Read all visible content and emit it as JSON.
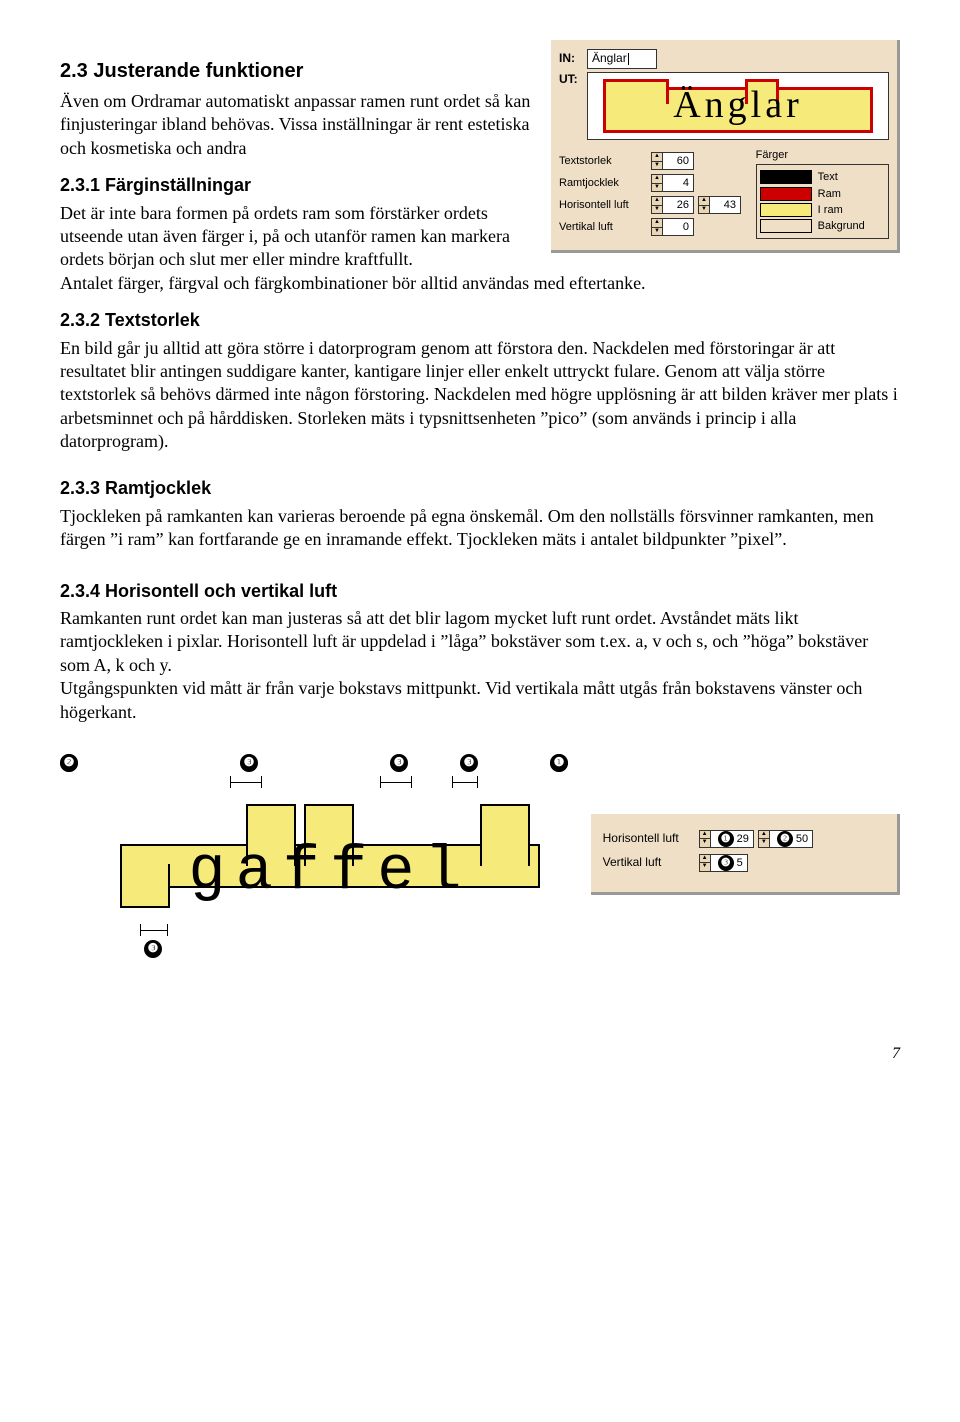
{
  "section": {
    "h_2_3": "2.3  Justerande funktioner",
    "p_2_3": "Även om Ordramar automatiskt anpassar ramen runt ordet så kan finjusteringar ibland behövas. Vissa inställningar är rent estetiska och kosmetiska och andra",
    "h_2_3_1": "2.3.1  Färginställningar",
    "p_2_3_1": "Det är inte bara formen på ordets ram som förstärker ordets utseende utan även färger i, på och utanför ramen kan markera ordets början och slut mer eller mindre kraftfullt.\nAntalet färger, färgval och färgkombinationer bör alltid användas med eftertanke.",
    "h_2_3_2": "2.3.2  Textstorlek",
    "p_2_3_2": "En bild går ju alltid att göra större i datorprogram genom att förstora den. Nackdelen med förstoringar är att resultatet blir antingen suddigare kanter, kantigare linjer eller enkelt uttryckt fulare. Genom att välja större textstorlek så behövs därmed inte någon förstoring. Nackdelen med högre upplösning är att bilden kräver mer plats i arbetsminnet och på hårddisken. Storleken mäts i typsnittsenheten ”pico” (som används i princip i alla datorprogram).",
    "h_2_3_3": "2.3.3  Ramtjocklek",
    "p_2_3_3": "Tjockleken på ramkanten kan varieras beroende på egna önskemål. Om den nollställs försvinner ramkanten, men färgen ”i ram” kan fortfarande ge en inramande effekt. Tjockleken mäts i antalet bildpunkter ”pixel”.",
    "h_2_3_4": "2.3.4  Horisontell och vertikal luft",
    "p_2_3_4": "Ramkanten runt ordet kan man justeras så att det blir lagom mycket luft runt ordet. Avståndet mäts likt ramtjockleken i pixlar. Horisontell luft är uppdelad i ”låga” bokstäver som t.ex.  a, v och s, och ”höga” bokstäver som A, k och y.\nUtgångspunkten vid mått är från varje bokstavs mittpunkt. Vid vertikala mått utgås från bokstavens vänster och högerkant."
  },
  "panel": {
    "in_label": "IN:",
    "in_value": "Änglar",
    "ut_label": "UT:",
    "preview_word": "Änglar",
    "controls": {
      "textstorlek": {
        "label": "Textstorlek",
        "value": "60"
      },
      "ramtjocklek": {
        "label": "Ramtjocklek",
        "value": "4"
      },
      "horisontell": {
        "label": "Horisontell luft",
        "value1": "26",
        "value2": "43"
      },
      "vertikal": {
        "label": "Vertikal luft",
        "value": "0"
      }
    },
    "colors": {
      "title": "Färger",
      "text": "Text",
      "ram": "Ram",
      "iram": "I ram",
      "bakgrund": "Bakgrund"
    }
  },
  "gaffel": {
    "word": "gaffel"
  },
  "mini": {
    "horisontell": {
      "label": "Horisontell luft",
      "v1": "29",
      "v2": "50"
    },
    "vertikal": {
      "label": "Vertikal luft",
      "v1": "5"
    }
  },
  "badges": {
    "one": "❶",
    "two": "❷",
    "three": "❸"
  },
  "page_number": "7"
}
